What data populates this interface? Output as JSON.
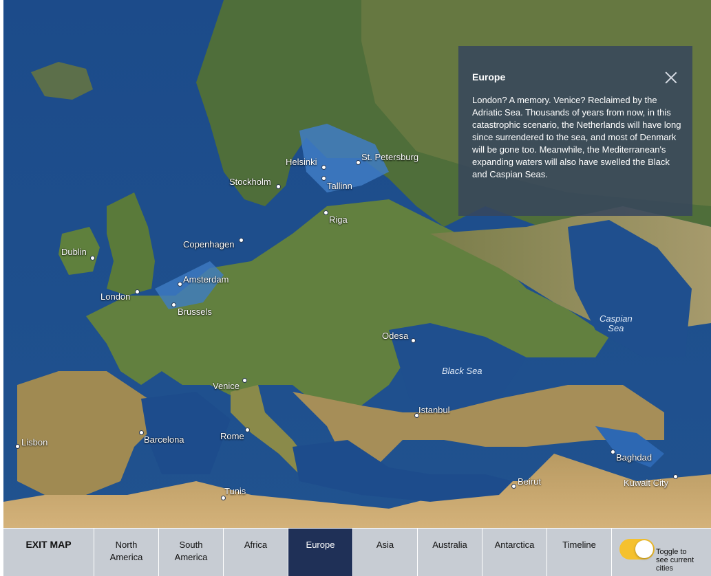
{
  "info_panel": {
    "title": "Europe",
    "body": "London? A memory. Venice? Reclaimed by the Adriatic Sea. Thousands of years from now, in this catastrophic scenario, the Netherlands will have long since surrendered to the sea, and most of Denmark will be gone too. Meanwhile, the Mediterranean's expanding waters will also have swelled the Black and Caspian Seas."
  },
  "cities": {
    "helsinki": "Helsinki",
    "st_petersburg": "St. Petersburg",
    "stockholm": "Stockholm",
    "tallinn": "Tallinn",
    "riga": "Riga",
    "copenhagen": "Copenhagen",
    "dublin": "Dublin",
    "amsterdam": "Amsterdam",
    "london": "London",
    "brussels": "Brussels",
    "odesa": "Odesa",
    "venice": "Venice",
    "istanbul": "Istanbul",
    "lisbon": "Lisbon",
    "barcelona": "Barcelona",
    "rome": "Rome",
    "baghdad": "Baghdad",
    "kuwait_city": "Kuwait City",
    "beirut": "Beirut",
    "tunis": "Tunis"
  },
  "seas": {
    "caspian_line1": "Caspian",
    "caspian_line2": "Sea",
    "black_sea": "Black Sea"
  },
  "nav": {
    "exit": "EXIT MAP",
    "north_america_1": "North",
    "north_america_2": "America",
    "south_america_1": "South",
    "south_america_2": "America",
    "africa": "Africa",
    "europe": "Europe",
    "asia": "Asia",
    "australia": "Australia",
    "antarctica": "Antarctica",
    "timeline": "Timeline",
    "active": "Europe"
  },
  "toggle": {
    "label": "Toggle to see current cities",
    "on": true
  },
  "colors": {
    "ocean": "#1d4c8c",
    "shallow": "#3f7cc4",
    "land_green": "#5f7f3b",
    "land_tan": "#a99660",
    "active_tab": "#1f3057",
    "toggle_on": "#f5c12e"
  }
}
